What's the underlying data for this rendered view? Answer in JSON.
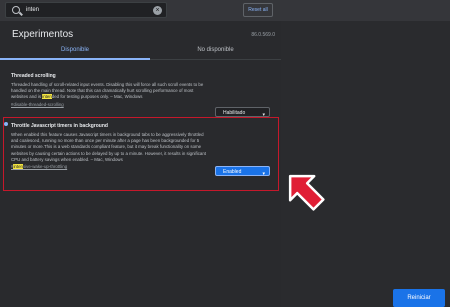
{
  "search": {
    "query": "inten"
  },
  "header": {
    "reset_label": "Reset all"
  },
  "page": {
    "title": "Experimentos",
    "version": "86.0.569.0"
  },
  "tabs": [
    {
      "label": "Disponible"
    },
    {
      "label": "No disponible"
    }
  ],
  "experiments": [
    {
      "name": "Threaded scrolling",
      "desc_before": "Threaded handling of scroll-related input events. Disabling this will force all such scroll events to be handled on the main thread. Note that this can dramatically hurt scrolling performance of most websites and is ",
      "desc_highlight": "inten",
      "desc_after": "ded for testing purposes only. – Mac, Windows",
      "link": "#disable-threaded-scrolling",
      "value": "Habilitado"
    },
    {
      "name": "Throttle Javascript timers in background",
      "desc": "When enabled this feature causes Javascript timers in background tabs to be aggressively throttled and coalesced, running no more than once per minute after a page has been backgrounded for 5 minutes or more.This is a web standards compliant feature, but it may break functionality on some websites by causing certain actions to be delayed by up to a minute. However, it results in significant CPU and battery savings when enabled. – Mac, Windows",
      "link_prefix": "#",
      "link_highlight": "inten",
      "link_suffix": "sive-wake-up-throttling",
      "value": "Enabled"
    }
  ],
  "footer": {
    "restart_label": "Reiniciar"
  },
  "colors": {
    "accent": "#1a73e8",
    "highlight_box": "#c5182b",
    "arrow": "#e01f36"
  }
}
